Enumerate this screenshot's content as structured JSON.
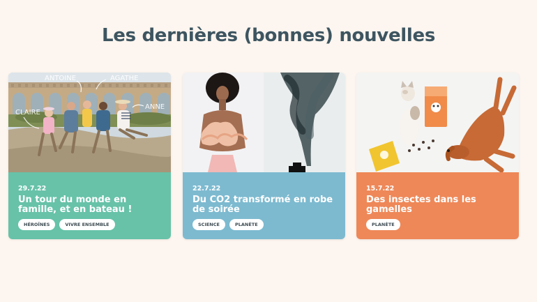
{
  "section": {
    "title": "Les dernières (bonnes) nouvelles"
  },
  "cards": [
    {
      "date": "29.7.22",
      "title": "Un tour du monde en famille, et en bateau !",
      "tags": [
        "HÉROÏNES",
        "VIVRE ENSEMBLE"
      ],
      "color": "#67c2a8",
      "photo_labels": [
        "ANTOINE",
        "AGATHE",
        "CLAIRE",
        "ANNE"
      ]
    },
    {
      "date": "22.7.22",
      "title": "Du CO2 transformé en robe de soirée",
      "tags": [
        "SCIENCE",
        "PLANÈTE"
      ],
      "color": "#7dbad0"
    },
    {
      "date": "15.7.22",
      "title": "Des insectes dans les gamelles",
      "tags": [
        "PLANÈTE"
      ],
      "color": "#ee8858"
    }
  ]
}
